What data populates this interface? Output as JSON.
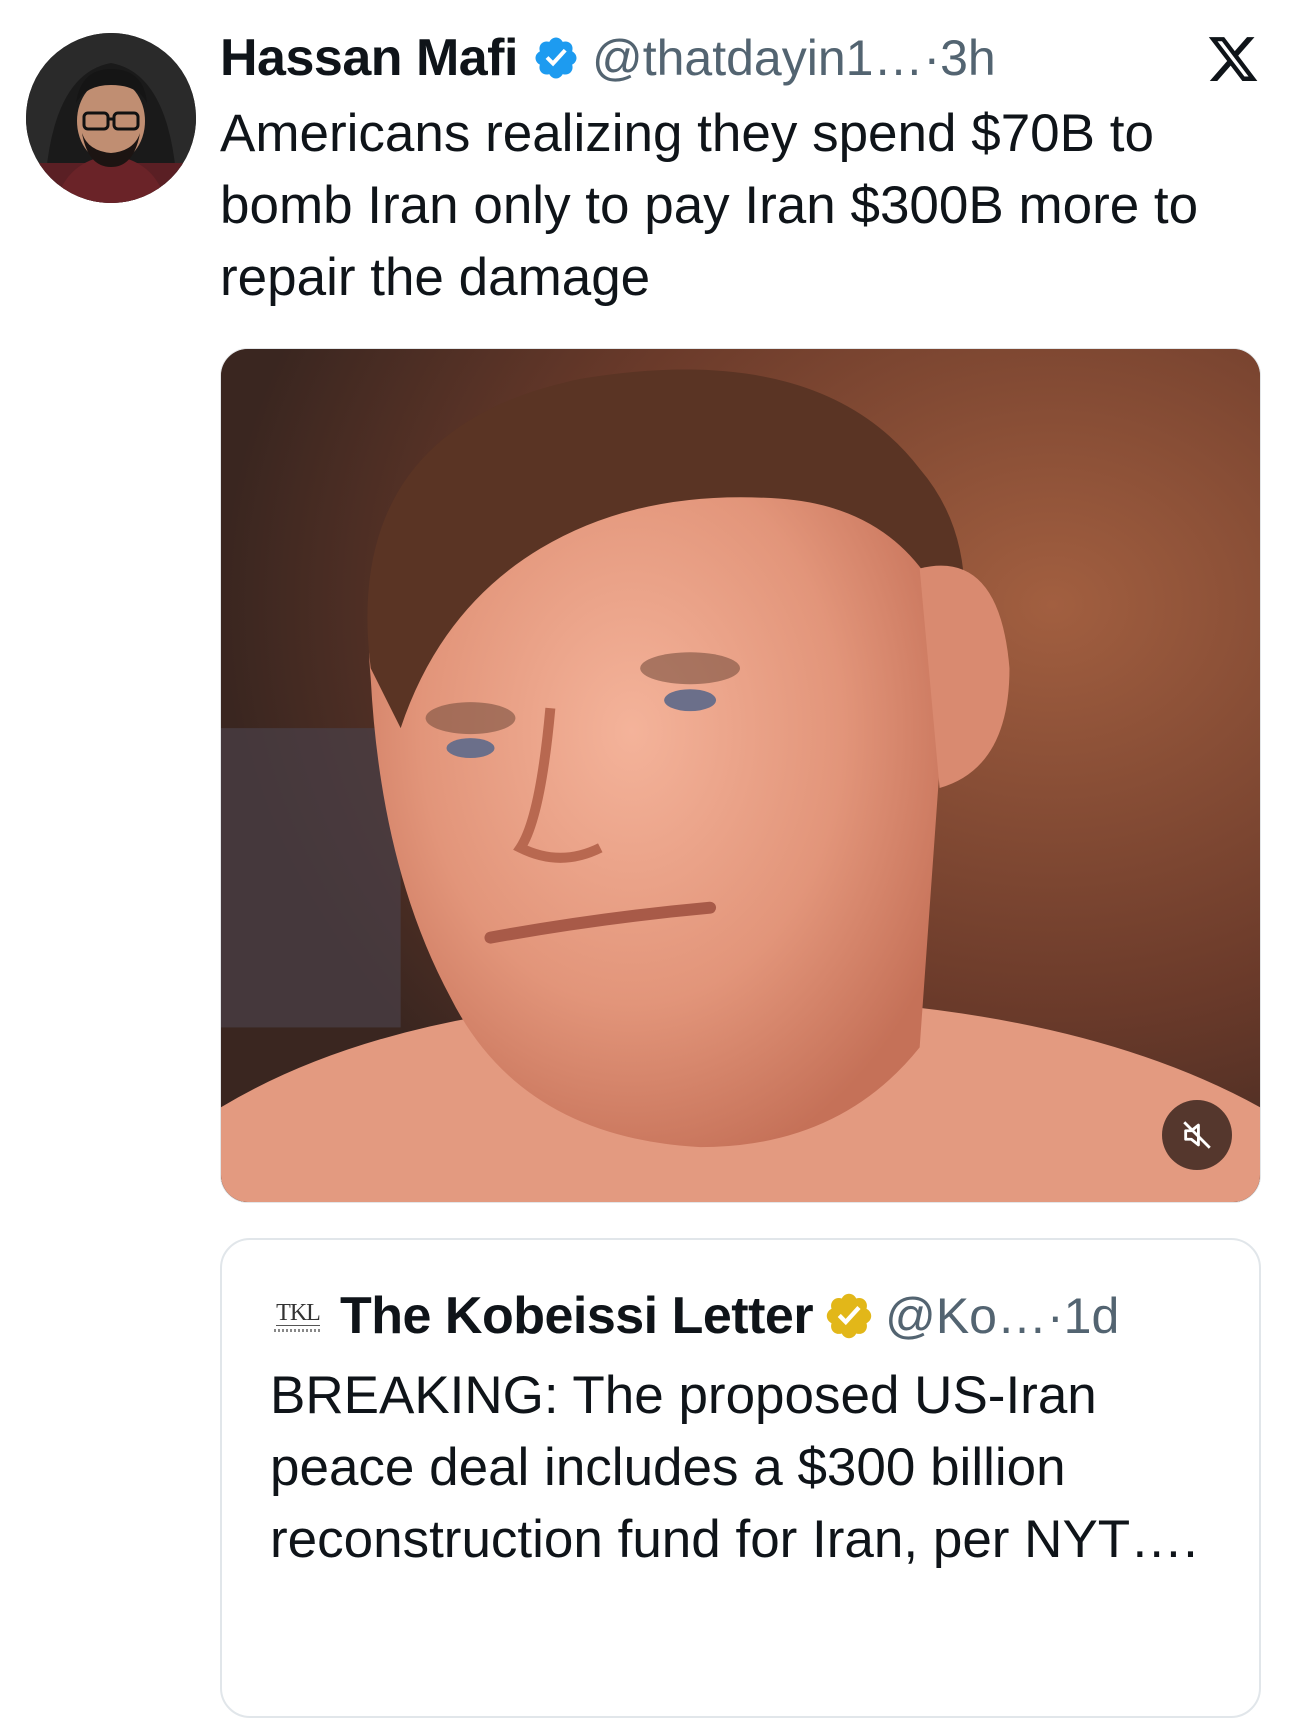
{
  "tweet": {
    "author": {
      "display_name": "Hassan Mafi",
      "handle": "@thatdayin1…",
      "time_separator": "·",
      "time": "3h",
      "verified": true,
      "verified_color": "#1d9bf0"
    },
    "text": "Americans realizing they spend $70B to bomb Iran only to pay Iran $300B more to repair the damage",
    "media": {
      "type": "video",
      "muted": true,
      "mute_icon": "muted-speaker-icon"
    },
    "platform_icon": "x-logo-icon"
  },
  "quoted_tweet": {
    "logo_text": "TKL",
    "display_name": "The Kobeissi Letter",
    "handle": "@Ko…",
    "time_separator": "·",
    "time": "1d",
    "verified": true,
    "verified_color": "#e2b719",
    "text": "BREAKING: The proposed US-Iran peace deal includes a $300 billion reconstruction fund for Iran, per NYT…."
  }
}
